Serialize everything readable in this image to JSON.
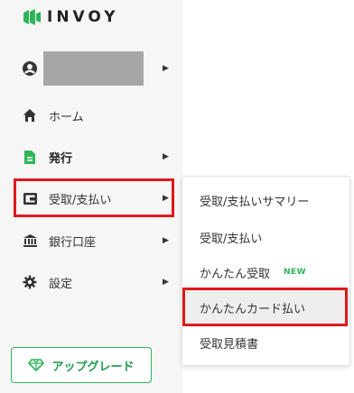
{
  "brand": {
    "name": "INVOY",
    "color": "#2fb45a"
  },
  "sidebar": {
    "items": [
      {
        "label": "ホーム",
        "icon": "home-icon"
      },
      {
        "label": "発行",
        "icon": "document-icon"
      },
      {
        "label": "受取/支払い",
        "icon": "wallet-icon"
      },
      {
        "label": "銀行口座",
        "icon": "bank-icon"
      },
      {
        "label": "設定",
        "icon": "gear-icon"
      }
    ],
    "upgrade_label": "アップグレード"
  },
  "submenu": {
    "items": [
      {
        "label": "受取/支払いサマリー"
      },
      {
        "label": "受取/支払い"
      },
      {
        "label": "かんたん受取",
        "badge": "NEW"
      },
      {
        "label": "かんたんカード払い"
      },
      {
        "label": "受取見積書"
      }
    ]
  },
  "colors": {
    "highlight": "#e0191b",
    "accent": "#2fb45a"
  }
}
